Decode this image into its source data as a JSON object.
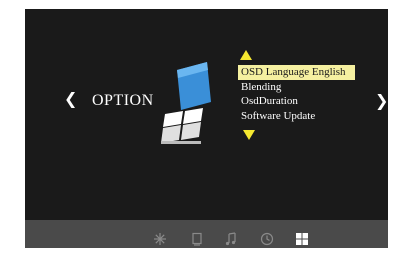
{
  "header": {
    "title": "OPTION",
    "left_nav_glyph": "❮",
    "right_nav_glyph": "❯"
  },
  "menu": {
    "items": [
      {
        "label": "OSD Language English",
        "selected": true
      },
      {
        "label": "Blending",
        "selected": false
      },
      {
        "label": "OsdDuration",
        "selected": false
      },
      {
        "label": "Software Update",
        "selected": false
      }
    ]
  },
  "icons": {
    "category_icon": "option-settings-icon",
    "scroll_up": "triangle-up-icon",
    "scroll_down": "triangle-down-icon"
  },
  "bottom_bar": {
    "items": [
      {
        "icon": "picture-icon",
        "active": false
      },
      {
        "icon": "tablet-icon",
        "active": false
      },
      {
        "icon": "music-note-icon",
        "active": false
      },
      {
        "icon": "clock-icon",
        "active": false
      },
      {
        "icon": "option-grid-icon",
        "active": true
      }
    ]
  },
  "colors": {
    "background": "#1a1a1a",
    "bottom_bar": "#4a4a4a",
    "highlight": "#f5f0a0",
    "arrow": "#f5e830",
    "accent_blue": "#3a8fd8"
  }
}
